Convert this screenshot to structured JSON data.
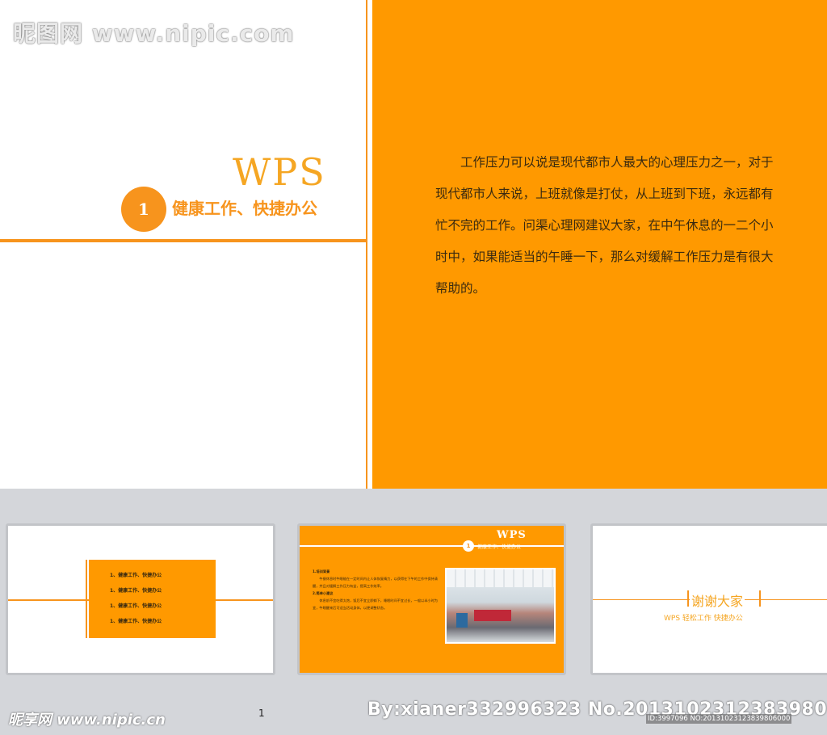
{
  "watermark": {
    "top": "昵图网 www.nipic.com",
    "bottom_left": "昵享网 www.nipic.cn",
    "by_line": "By:xianer332996323  No.20131023123839806",
    "id_line": "ID:3997096 NO:20131023123839806000"
  },
  "slide_main": {
    "title": "WPS",
    "number": "1",
    "subtitle": "健康工作、快捷办公"
  },
  "slide_text": {
    "lines": [
      "工作压力可以说是现代都市人最大的心理压力之一，对于",
      "现代都市人来说，上班就像是打仗，从上班到下班，永远都有",
      "忙不完的工作。问渠心理网建议大家，在中午休息的一二个小",
      "时中，如果能适当的午睡一下，那么对缓解工作压力是有很大",
      "帮助的。"
    ]
  },
  "thumbnails": {
    "thumb1": {
      "items": [
        "1、健康工作、快捷办公",
        "1、健康工作、快捷办公",
        "1、健康工作、快捷办公",
        "1、健康工作、快捷办公"
      ]
    },
    "thumb2": {
      "title": "WPS",
      "number": "1",
      "subtitle": "健康工作、快捷办公",
      "heading1": "1.培训背景",
      "para1": "午餐休息时午睡能在一定时间内让人体恢复精力，以获得在下午的工作中保持清醒，并且对缓解工作压力有益，提高工作效率。",
      "heading2": "2.简单小建议",
      "para2": "休息前不宜吃得太饱，饭后不宜立即躺下，睡眠时间不宜过长，一般以半小时为宜，午睡醒来后可适当活动身体，以便调整状态。"
    },
    "thumb3": {
      "thanks": "谢谢大家",
      "sub": "WPS 轻松工作 快捷办公"
    }
  },
  "page_number": "1",
  "colors": {
    "accent": "#ff9900",
    "accent_dark": "#f7941d",
    "panel_gray": "#d4d6da"
  }
}
